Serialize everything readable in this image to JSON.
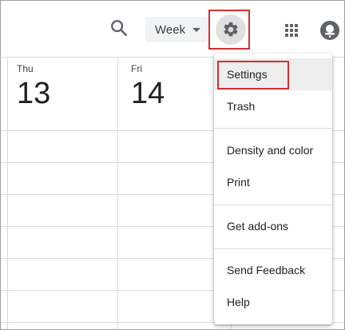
{
  "toolbar": {
    "view_label": "Week"
  },
  "days": [
    {
      "name": "Thu",
      "number": "13"
    },
    {
      "name": "Fri",
      "number": "14"
    }
  ],
  "menu": {
    "items": [
      {
        "label": "Settings"
      },
      {
        "label": "Trash"
      },
      {
        "label": "Density and color"
      },
      {
        "label": "Print"
      },
      {
        "label": "Get add-ons"
      },
      {
        "label": "Send Feedback"
      },
      {
        "label": "Help"
      }
    ]
  },
  "icons": {
    "search": "search-icon",
    "dropdown": "caret-down-icon",
    "settings": "gear-icon",
    "apps": "apps-grid-icon",
    "account": "account-avatar-icon"
  },
  "colors": {
    "highlight": "#d32f2f",
    "icon": "#5f6368",
    "gear_bg": "#e0e0e0",
    "menu_hover": "#eeeeee"
  }
}
